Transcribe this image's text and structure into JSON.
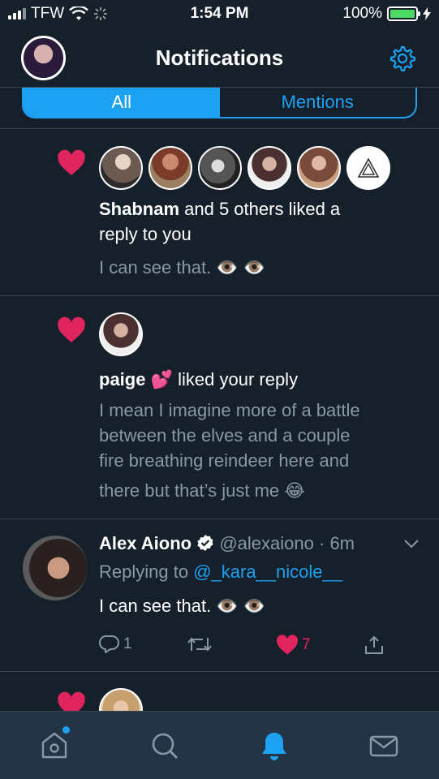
{
  "status_bar": {
    "carrier": "TFW",
    "time": "1:54 PM",
    "battery": "100%",
    "battery_level": 1.0
  },
  "header": {
    "title": "Notifications"
  },
  "tabs": [
    {
      "label": "All",
      "active": true
    },
    {
      "label": "Mentions",
      "active": false
    }
  ],
  "notifications": [
    {
      "type": "like",
      "actor": "Shabnam",
      "text": " and 5 others liked a",
      "text2": "reply to you",
      "preview": "I can see that. 👁️ 👁️",
      "avatar_count": 6
    },
    {
      "type": "like",
      "actor": "paige",
      "actor_emoji": "💕",
      "text": " liked your reply",
      "preview_lines": [
        "I mean I imagine more of a battle",
        "between the elves and a couple",
        "fire breathing reindeer here and",
        "there but that’s just me 😂"
      ]
    }
  ],
  "tweet": {
    "name": "Alex Aiono",
    "verified_icon": "verified-badge-icon",
    "handle": "@alexaiono",
    "time": "· 6m",
    "replying_prefix": "Replying to ",
    "replying_to": "@_kara__nicole__",
    "text": "I can see that. 👁️ 👁️",
    "replies": "1",
    "likes": "7"
  },
  "tab_bar": [
    "home-icon",
    "search-icon",
    "notifications-icon",
    "messages-icon"
  ],
  "colors": {
    "background": "#15202b",
    "accent": "#1da1f2",
    "like": "#e0245e",
    "secondary_text": "#8899a6"
  }
}
